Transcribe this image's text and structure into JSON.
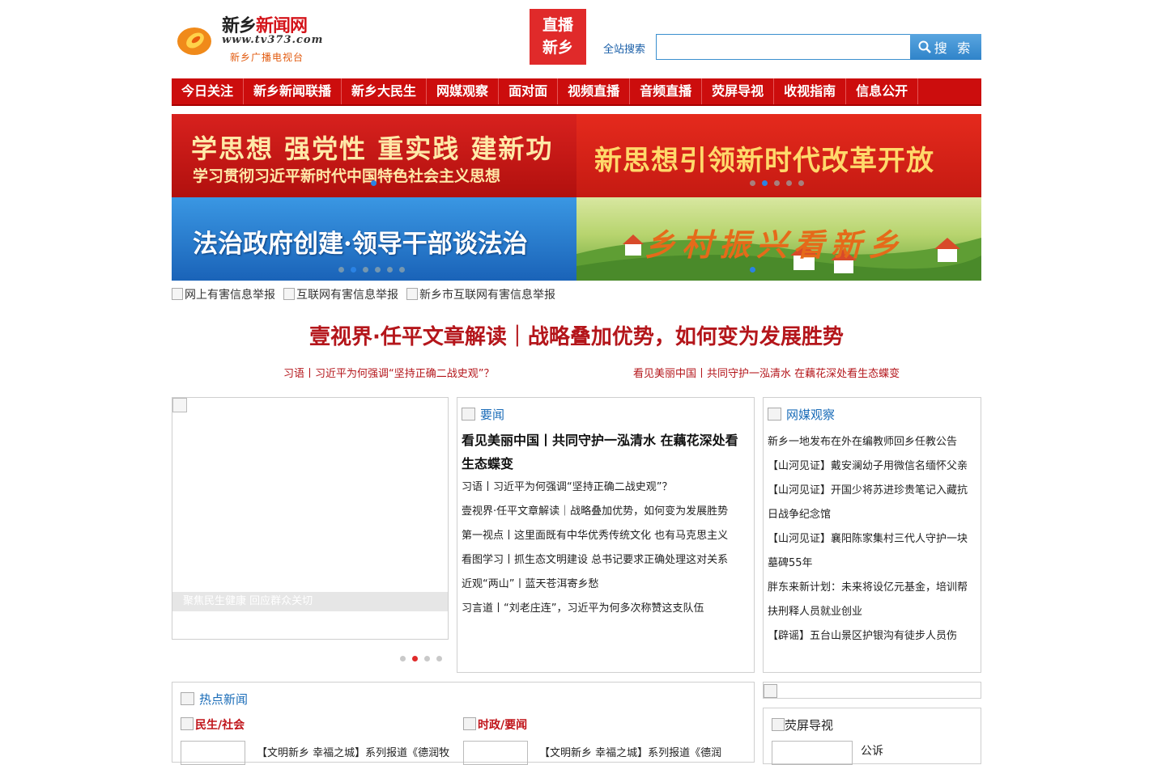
{
  "header": {
    "site_name_black": "新乡",
    "site_name_red": "新闻网",
    "site_url": "www.tv373.com",
    "site_sub": "新乡广播电视台",
    "live_line1": "直播",
    "live_line2": "新乡",
    "search_label": "全站搜索",
    "search_value": "",
    "search_button": "搜 索"
  },
  "nav": [
    "今日关注",
    "新乡新闻联播",
    "新乡大民生",
    "网媒观察",
    "面对面",
    "视频直播",
    "音频直播",
    "荧屏导视",
    "收视指南",
    "信息公开"
  ],
  "banners": {
    "b1_line1": "学思想 强党性 重实践 建新功",
    "b1_line2": "学习贯彻习近平新时代中国特色社会主义思想",
    "b2_line1": "新思想引领新时代改革开放",
    "b3_line1": "法治政府创建·领导干部谈法治",
    "b4_line1": "乡村振兴看新乡"
  },
  "report_links": [
    "网上有害信息举报",
    "互联网有害信息举报",
    "新乡市互联网有害信息举报"
  ],
  "headline": {
    "main": "壹视界·任平文章解读｜战略叠加优势，如何变为发展胜势",
    "sub_left": "习语丨习近平为何强调“坚持正确二战史观”？",
    "sub_right": "看见美丽中国丨共同守护一泓清水 在藕花深处看生态蝶变"
  },
  "slideshow": {
    "caption": "聚焦民生健康 回应群众关切"
  },
  "news": {
    "title": "要闻",
    "lead": "看见美丽中国丨共同守护一泓清水 在藕花深处看生态蝶变",
    "items": [
      "习语丨习近平为何强调“坚持正确二战史观”？",
      "壹视界·任平文章解读｜战略叠加优势，如何变为发展胜势",
      "第一视点丨这里面既有中华优秀传统文化 也有马克思主义",
      "看图学习丨抓生态文明建设 总书记要求正确处理这对关系",
      "近观“两山”丨蓝天苍洱寄乡愁",
      "习言道丨“刘老庄连”，习近平为何多次称赞这支队伍"
    ]
  },
  "media": {
    "title": "网媒观察",
    "items": [
      "新乡一地发布在外在编教师回乡任教公告",
      "【山河见证】戴安澜幼子用微信名缅怀父亲",
      "【山河见证】开国少将苏进珍贵笔记入藏抗日战争纪念馆",
      "【山河见证】襄阳陈家集村三代人守护一块墓碑55年",
      "胖东来新计划：未来将设亿元基金，培训帮扶刑释人员就业创业",
      "【辟谣】五台山景区护银沟有徒步人员伤"
    ]
  },
  "hot": {
    "title": "热点新闻",
    "cat_left": "民生/社会",
    "cat_right": "时政/要闻",
    "line_left": "【文明新乡 幸福之城】系列报道《德润牧",
    "line_right": "【文明新乡 幸福之城】系列报道《德润"
  },
  "guide": {
    "title": "荧屏导视",
    "item": "公诉"
  }
}
